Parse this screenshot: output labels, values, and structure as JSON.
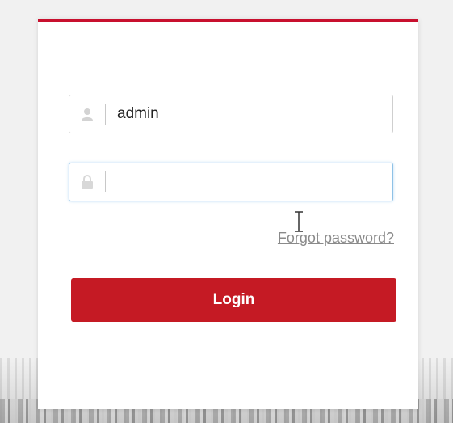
{
  "login_form": {
    "username": {
      "value": "admin",
      "icon": "user-icon"
    },
    "password": {
      "value": "",
      "icon": "lock-icon"
    },
    "forgot_password_label": "Forgot password?",
    "login_label": "Login"
  },
  "colors": {
    "accent": "#c8102e",
    "focus_border": "#8fc2e6"
  }
}
